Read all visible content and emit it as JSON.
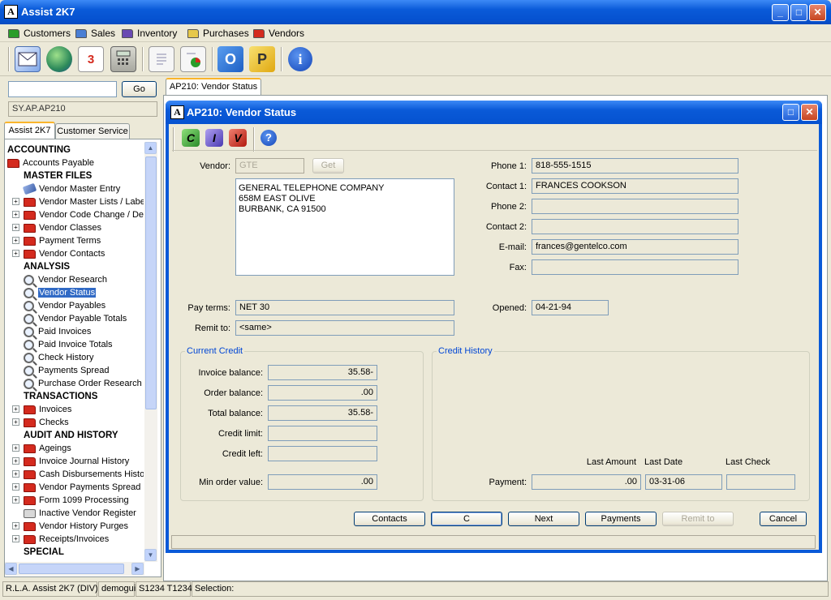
{
  "app": {
    "title": "Assist 2K7",
    "icon": "app-logo-icon",
    "min": "_",
    "max": "□",
    "close": "✕"
  },
  "menu": [
    {
      "label": "Customers",
      "color": "#2a9d2a"
    },
    {
      "label": "Sales",
      "color": "#4a7fd4"
    },
    {
      "label": "Inventory",
      "color": "#6a4ab2"
    },
    {
      "label": "Purchases",
      "color": "#e6c84a"
    },
    {
      "label": "Vendors",
      "color": "#d42a1e"
    }
  ],
  "toolbar": {
    "icons": [
      "mail-icon",
      "globe-icon",
      "calendar-icon",
      "calculator-icon",
      "form-icon",
      "report-chart-icon",
      "outlook-icon",
      "publisher-icon",
      "info-icon"
    ],
    "calendar_digit": "3",
    "o_letter": "O",
    "p_letter": "P",
    "info_letter": "i"
  },
  "search": {
    "value": "",
    "go": "Go",
    "path": "SY.AP.AP210"
  },
  "left_tabs": [
    "Assist 2K7",
    "Customer Service"
  ],
  "tree": [
    {
      "label": "ACCOUNTING",
      "type": "header",
      "indent": 0
    },
    {
      "label": "Accounts Payable",
      "type": "folder",
      "indent": 0
    },
    {
      "label": "MASTER FILES",
      "type": "header",
      "indent": 20
    },
    {
      "label": "Vendor Master Entry",
      "type": "entry",
      "indent": 20
    },
    {
      "label": "Vendor Master Lists / Labels",
      "type": "folder-exp",
      "indent": 20
    },
    {
      "label": "Vendor Code Change / Delete",
      "type": "folder-exp",
      "indent": 20
    },
    {
      "label": "Vendor Classes",
      "type": "folder-exp",
      "indent": 20
    },
    {
      "label": "Payment Terms",
      "type": "folder-exp",
      "indent": 20
    },
    {
      "label": "Vendor Contacts",
      "type": "folder-exp",
      "indent": 20
    },
    {
      "label": "ANALYSIS",
      "type": "header",
      "indent": 20
    },
    {
      "label": "Vendor Research",
      "type": "mag",
      "indent": 20
    },
    {
      "label": "Vendor Status",
      "type": "mag",
      "indent": 20,
      "selected": true
    },
    {
      "label": "Vendor Payables",
      "type": "mag",
      "indent": 20
    },
    {
      "label": "Vendor Payable Totals",
      "type": "mag",
      "indent": 20
    },
    {
      "label": "Paid Invoices",
      "type": "mag",
      "indent": 20
    },
    {
      "label": "Paid Invoice Totals",
      "type": "mag",
      "indent": 20
    },
    {
      "label": "Check History",
      "type": "mag",
      "indent": 20
    },
    {
      "label": "Payments Spread",
      "type": "mag",
      "indent": 20
    },
    {
      "label": "Purchase Order Research",
      "type": "mag",
      "indent": 20
    },
    {
      "label": "TRANSACTIONS",
      "type": "header",
      "indent": 20
    },
    {
      "label": "Invoices",
      "type": "folder-exp",
      "indent": 20
    },
    {
      "label": "Checks",
      "type": "folder-exp",
      "indent": 20
    },
    {
      "label": "AUDIT AND HISTORY",
      "type": "header",
      "indent": 20
    },
    {
      "label": "Ageings",
      "type": "folder-exp",
      "indent": 20
    },
    {
      "label": "Invoice Journal History",
      "type": "folder-exp",
      "indent": 20
    },
    {
      "label": "Cash Disbursements History",
      "type": "folder-exp",
      "indent": 20
    },
    {
      "label": "Vendor Payments Spread Report",
      "type": "folder-exp",
      "indent": 20
    },
    {
      "label": "Form 1099 Processing",
      "type": "folder-exp",
      "indent": 20
    },
    {
      "label": "Inactive Vendor Register",
      "type": "printer",
      "indent": 20
    },
    {
      "label": "Vendor History Purges",
      "type": "folder-exp",
      "indent": 20
    },
    {
      "label": "Receipts/Invoices",
      "type": "folder-exp",
      "indent": 20
    },
    {
      "label": "SPECIAL",
      "type": "header",
      "indent": 20
    }
  ],
  "doc_tab": "AP210: Vendor Status",
  "dialog": {
    "title": "AP210: Vendor Status",
    "tool_letters": [
      "C",
      "I",
      "V",
      "?"
    ],
    "vendor_label": "Vendor:",
    "vendor_code": "GTE",
    "get": "Get",
    "address": [
      "GENERAL TELEPHONE COMPANY",
      "658M EAST OLIVE",
      "BURBANK, CA 91500"
    ],
    "right_fields": [
      {
        "label": "Phone 1:",
        "value": "818-555-1515"
      },
      {
        "label": "Contact 1:",
        "value": "FRANCES COOKSON"
      },
      {
        "label": "Phone 2:",
        "value": ""
      },
      {
        "label": "Contact 2:",
        "value": ""
      },
      {
        "label": "E-mail:",
        "value": "frances@gentelco.com"
      },
      {
        "label": "Fax:",
        "value": ""
      }
    ],
    "pay_terms_label": "Pay terms:",
    "pay_terms": "NET 30",
    "remit_label": "Remit to:",
    "remit": "<same>",
    "opened_label": "Opened:",
    "opened": "04-21-94",
    "current_credit": {
      "title": "Current Credit",
      "rows": [
        {
          "label": "Invoice balance:",
          "value": "35.58-"
        },
        {
          "label": "Order balance:",
          "value": ".00"
        },
        {
          "label": "Total balance:",
          "value": "35.58-"
        },
        {
          "label": "Credit limit:",
          "value": ""
        },
        {
          "label": "Credit left:",
          "value": ""
        }
      ],
      "min_label": "Min order value:",
      "min_value": ".00"
    },
    "credit_history": {
      "title": "Credit History",
      "cols": [
        "Last Amount",
        "Last Date",
        "Last Check"
      ],
      "row_label": "Payment:",
      "amount": ".00",
      "date": "03-31-06",
      "check": ""
    },
    "buttons": [
      "Contacts",
      "C",
      "Next",
      "Payments",
      "Remit to",
      "Cancel"
    ]
  },
  "status": [
    "R.L.A. Assist 2K7 (DIV)",
    "demogui",
    "S1234 T1234",
    "Selection:"
  ]
}
